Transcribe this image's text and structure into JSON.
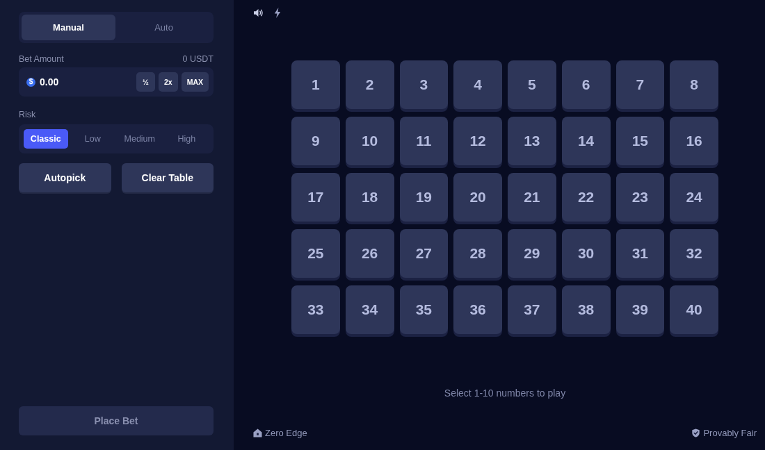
{
  "mode_tabs": [
    {
      "label": "Manual",
      "selected": true
    },
    {
      "label": "Auto",
      "selected": false
    }
  ],
  "bet_amount": {
    "label": "Bet Amount",
    "balance": "0 USDT",
    "currency_symbol": "$",
    "value": "0.00",
    "buttons": [
      "½",
      "2x",
      "MAX"
    ]
  },
  "risk": {
    "label": "Risk",
    "options": [
      {
        "label": "Classic",
        "selected": true
      },
      {
        "label": "Low",
        "selected": false
      },
      {
        "label": "Medium",
        "selected": false
      },
      {
        "label": "High",
        "selected": false
      }
    ]
  },
  "actions": [
    "Autopick",
    "Clear Table"
  ],
  "place_bet": {
    "label": "Place Bet",
    "disabled": true
  },
  "tiles": [
    {
      "label": "1",
      "selected": false
    },
    {
      "label": "2",
      "selected": false
    },
    {
      "label": "3",
      "selected": false
    },
    {
      "label": "4",
      "selected": false
    },
    {
      "label": "5",
      "selected": false
    },
    {
      "label": "6",
      "selected": false
    },
    {
      "label": "7",
      "selected": false
    },
    {
      "label": "8",
      "selected": false
    },
    {
      "label": "9",
      "selected": false
    },
    {
      "label": "10",
      "selected": false
    },
    {
      "label": "11",
      "selected": false
    },
    {
      "label": "12",
      "selected": false
    },
    {
      "label": "13",
      "selected": false
    },
    {
      "label": "14",
      "selected": false
    },
    {
      "label": "15",
      "selected": false
    },
    {
      "label": "16",
      "selected": false
    },
    {
      "label": "17",
      "selected": false
    },
    {
      "label": "18",
      "selected": false
    },
    {
      "label": "19",
      "selected": false
    },
    {
      "label": "20",
      "selected": false
    },
    {
      "label": "21",
      "selected": false
    },
    {
      "label": "22",
      "selected": false
    },
    {
      "label": "23",
      "selected": false
    },
    {
      "label": "24",
      "selected": false
    },
    {
      "label": "25",
      "selected": false
    },
    {
      "label": "26",
      "selected": false
    },
    {
      "label": "27",
      "selected": false
    },
    {
      "label": "28",
      "selected": false
    },
    {
      "label": "29",
      "selected": false
    },
    {
      "label": "30",
      "selected": false
    },
    {
      "label": "31",
      "selected": false
    },
    {
      "label": "32",
      "selected": false
    },
    {
      "label": "33",
      "selected": false
    },
    {
      "label": "34",
      "selected": false
    },
    {
      "label": "35",
      "selected": false
    },
    {
      "label": "36",
      "selected": false
    },
    {
      "label": "37",
      "selected": false
    },
    {
      "label": "38",
      "selected": false
    },
    {
      "label": "39",
      "selected": false
    },
    {
      "label": "40",
      "selected": false
    }
  ],
  "hint": "Select 1-10 numbers to play",
  "footer": {
    "left": "Zero Edge",
    "right": "Provably Fair"
  }
}
